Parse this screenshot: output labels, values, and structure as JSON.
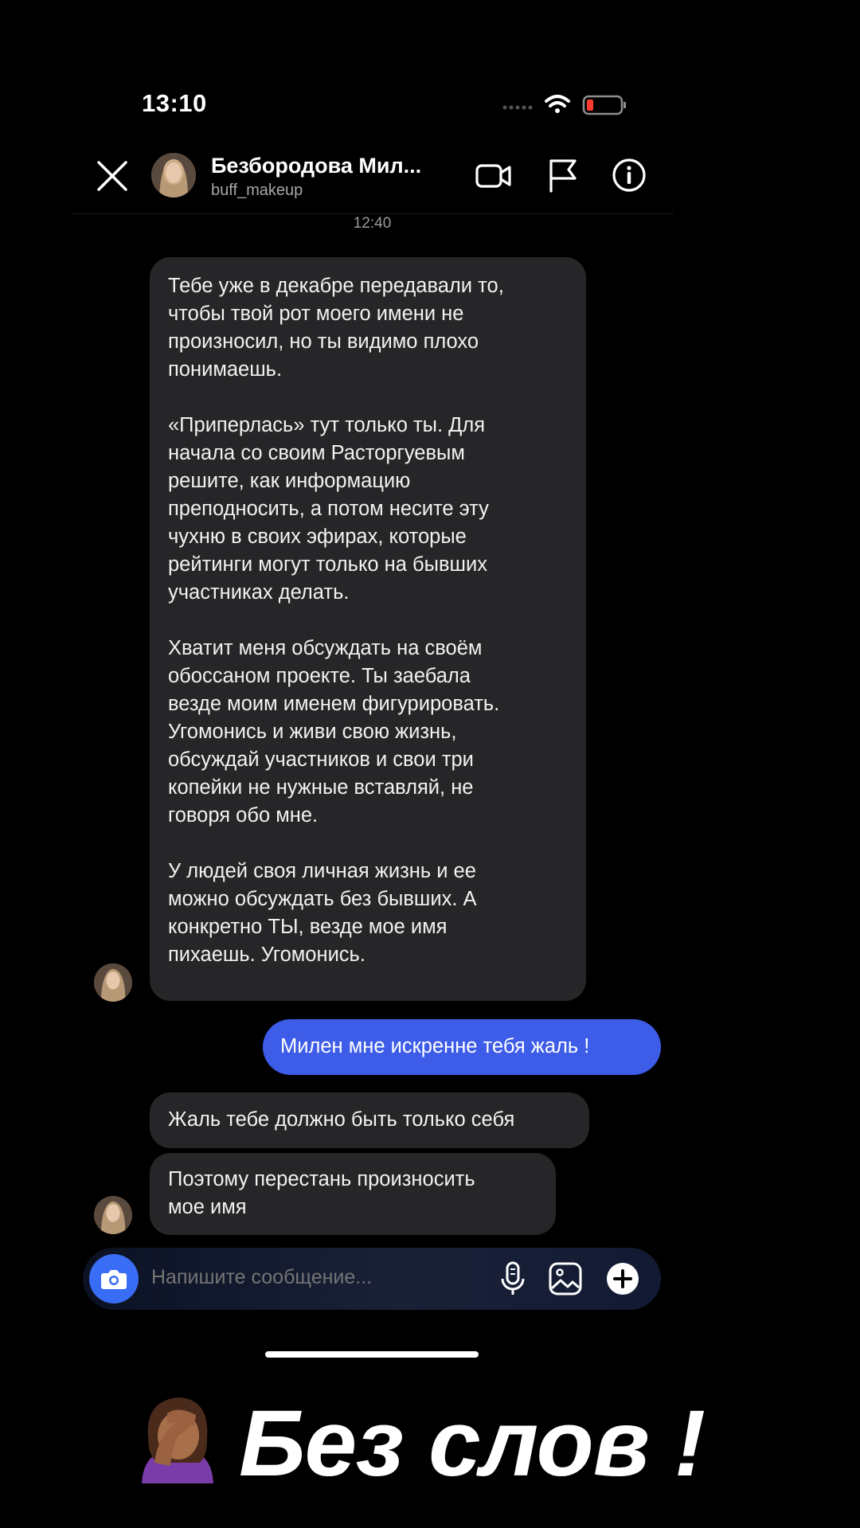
{
  "status_bar": {
    "time": "13:10"
  },
  "header": {
    "contact_name": "Безбородова Мил...",
    "username": "buff_makeup",
    "icons": [
      "close-icon",
      "video-call-icon",
      "flag-icon",
      "info-icon"
    ]
  },
  "chat": {
    "timestamp": "12:40",
    "messages": [
      {
        "direction": "incoming",
        "paragraphs": [
          [
            "Тебе уже в декабре передавали то,",
            "чтобы твой рот моего имени не",
            "произносил, но ты видимо плохо",
            "понимаешь."
          ],
          [
            "«Приперлась» тут только ты. Для",
            "начала со своим Расторгуевым",
            "решите, как информацию",
            "преподносить, а потом несите эту",
            "чухню в своих эфирах, которые",
            "рейтинги могут только на бывших",
            "участниках делать."
          ],
          [
            "Хватит меня обсуждать на своём",
            "обоссаном проекте. Ты заебала",
            "везде моим именем фигурировать.",
            "Угомонись и живи свою жизнь,",
            "обсуждай участников и свои три",
            "копейки не нужные вставляй, не",
            "говоря обо мне."
          ],
          [
            "У людей своя личная жизнь и ее",
            "можно обсуждать без бывших. А",
            "конкретно ТЫ, везде мое имя",
            "пихаешь. Угомонись."
          ]
        ]
      },
      {
        "direction": "outgoing",
        "text": "Милен мне искренне тебя жаль !"
      },
      {
        "direction": "incoming",
        "text": "Жаль тебе должно быть только себя"
      },
      {
        "direction": "incoming",
        "lines": [
          "Поэтому перестань произносить",
          "мое имя"
        ]
      }
    ]
  },
  "composer": {
    "placeholder": "Напишите сообщение...",
    "icons": [
      "camera-icon",
      "microphone-icon",
      "gallery-icon",
      "plus-icon"
    ]
  },
  "caption": {
    "emoji": "🤦🏾‍♀️",
    "text": "Без слов !"
  },
  "colors": {
    "background": "#000000",
    "incoming_bubble": "#262628",
    "outgoing_bubble": "#3d5ce8",
    "camera_button": "#3a6df5"
  }
}
